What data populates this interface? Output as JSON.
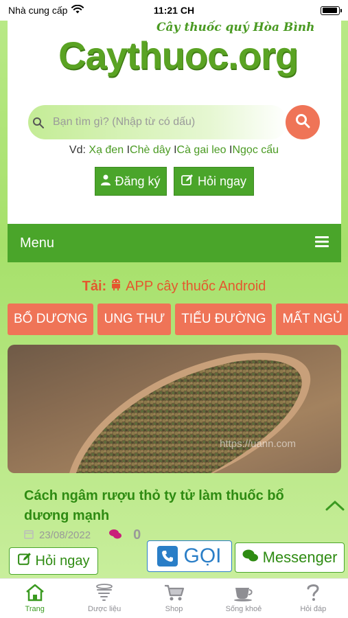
{
  "status_bar": {
    "carrier": "Nhà cung cấp",
    "time": "11:21 CH",
    "icons": [
      "wifi-icon",
      "battery-icon"
    ]
  },
  "header": {
    "logo_tagline": "Cây thuốc quý Hòa Bình",
    "logo_text": "Caythuoc.org"
  },
  "search": {
    "placeholder": "Bạn tìm gì? (Nhập từ có dấu)",
    "value": "",
    "button_icon": "search-icon"
  },
  "suggestions": {
    "prefix": "Vd:",
    "items": [
      "Xạ đen",
      "Chè dây",
      "Cà gai leo",
      "Ngọc cẩu"
    ],
    "separator": "I"
  },
  "account": {
    "register_label": "Đăng ký",
    "ask_label": "Hỏi ngay"
  },
  "menu": {
    "label": "Menu",
    "icon": "hamburger-icon"
  },
  "app_download": {
    "prefix": "Tải:",
    "text": "APP cây thuốc Android",
    "icon": "android-icon"
  },
  "categories": [
    "BỔ DƯƠNG",
    "UNG THƯ",
    "TIỂU ĐƯỜNG",
    "MẤT NGỦ"
  ],
  "article": {
    "title": "Cách ngâm rượu thỏ ty tử làm thuốc bổ dương mạnh",
    "date": "23/08/2022",
    "comments": "0",
    "watermark": "https://uann.com"
  },
  "floating": {
    "ask_label": "Hỏi ngay",
    "call_label": "GỌI",
    "messenger_label": "Messenger"
  },
  "tabbar": [
    {
      "label": "Trang",
      "icon": "home-icon",
      "active": true
    },
    {
      "label": "Dược liệu",
      "icon": "tornado-icon",
      "active": false
    },
    {
      "label": "Shop",
      "icon": "cart-icon",
      "active": false
    },
    {
      "label": "Sống khoẻ",
      "icon": "coffee-cup-icon",
      "active": false
    },
    {
      "label": "Hỏi đáp",
      "icon": "question-icon",
      "active": false
    }
  ],
  "colors": {
    "brand_green": "#4aa52a",
    "accent_orange": "#ef7457",
    "call_blue": "#2a7ec7",
    "page_bg": "#b8e986"
  }
}
